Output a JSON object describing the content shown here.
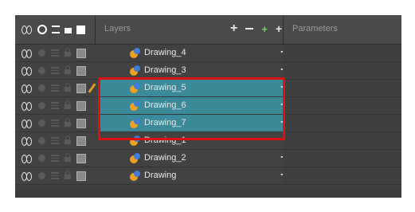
{
  "header": {
    "layers_label": "Layers",
    "parameters_label": "Parameters",
    "add_layer_icon": "add-layer-icon",
    "remove_layer_icon": "remove-layer-icon",
    "add_peg_icon": "add-peg-icon",
    "add_drawing_icon": "add-drawing-icon"
  },
  "layers": [
    {
      "name": "Drawing_4",
      "selected": false
    },
    {
      "name": "Drawing_3",
      "selected": false
    },
    {
      "name": "Drawing_5",
      "selected": true
    },
    {
      "name": "Drawing_6",
      "selected": true
    },
    {
      "name": "Drawing_7",
      "selected": true
    },
    {
      "name": "Drawing_1",
      "selected": false
    },
    {
      "name": "Drawing_2",
      "selected": false
    },
    {
      "name": "Drawing",
      "selected": false
    }
  ],
  "colors": {
    "selection": "#3a8a99",
    "highlight_box": "#e01010"
  }
}
